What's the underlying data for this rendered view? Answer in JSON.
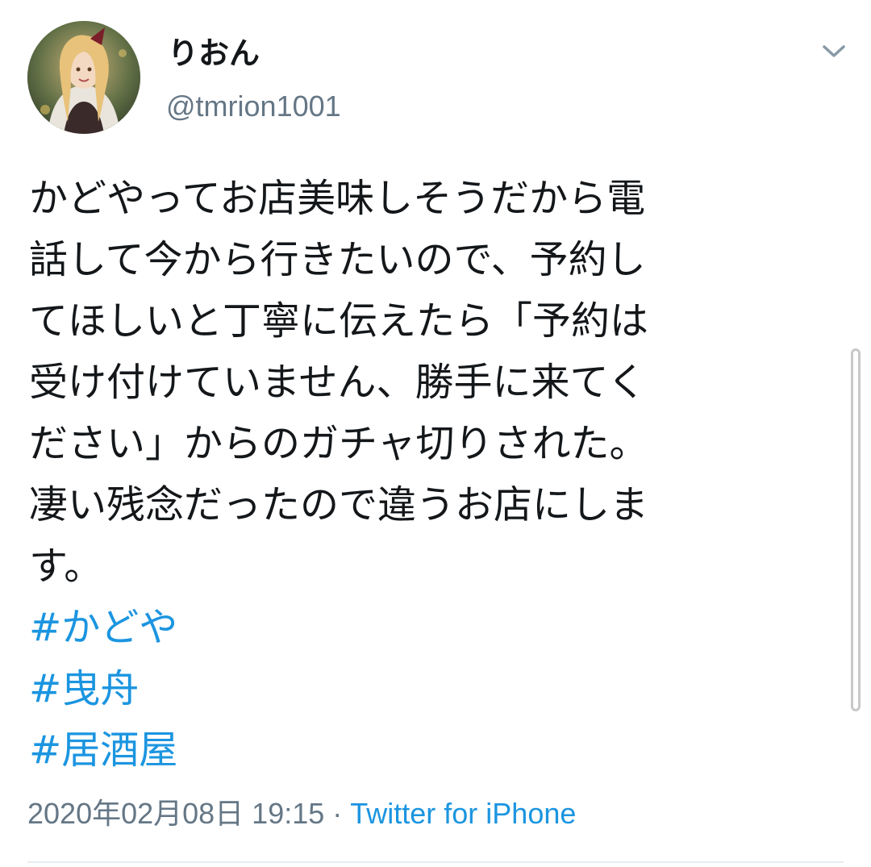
{
  "user": {
    "display_name": "りおん",
    "handle": "@tmrion1001",
    "avatar_icon": "anime-character-avatar"
  },
  "tweet": {
    "lines": [
      "かどやってお店美味しそうだから電",
      "話して今から行きたいので、予約し",
      "てほしいと丁寧に伝えたら「予約は",
      "受け付けていません、勝手に来てく",
      "ださい」からのガチャ切りされた。",
      "凄い残念だったので違うお店にしま",
      "す。"
    ],
    "hashtags": [
      "#かどや",
      "#曳舟",
      "#居酒屋"
    ]
  },
  "meta": {
    "timestamp": "2020年02月08日 19:15",
    "separator": " · ",
    "source": "Twitter for iPhone"
  },
  "menu": {
    "icon": "chevron-down-icon"
  },
  "colors": {
    "text": "#14171a",
    "secondary": "#657786",
    "link": "#1b95e0"
  }
}
